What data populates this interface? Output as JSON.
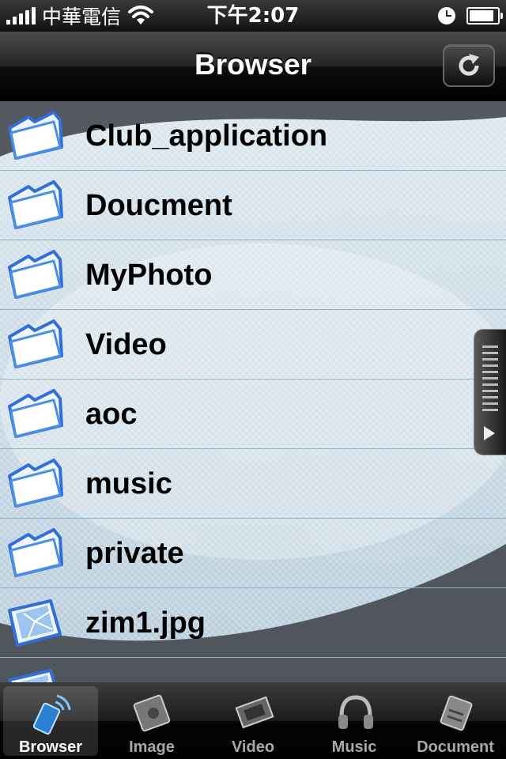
{
  "status_bar": {
    "carrier": "中華電信",
    "time": "下午2:07",
    "battery_level": 0.8
  },
  "navbar": {
    "title": "Browser"
  },
  "list": {
    "items": [
      {
        "label": "Club_application",
        "icon": "folder-icon"
      },
      {
        "label": "Doucment",
        "icon": "folder-icon"
      },
      {
        "label": "MyPhoto",
        "icon": "folder-icon"
      },
      {
        "label": "Video",
        "icon": "folder-icon"
      },
      {
        "label": "aoc",
        "icon": "folder-icon"
      },
      {
        "label": "music",
        "icon": "folder-icon"
      },
      {
        "label": "private",
        "icon": "folder-icon"
      },
      {
        "label": "zim1.jpg",
        "icon": "image-file-icon"
      },
      {
        "label": "",
        "icon": "image-file-icon"
      }
    ]
  },
  "tabbar": {
    "tabs": [
      {
        "label": "Browser",
        "icon": "phone-wireless-icon",
        "active": true
      },
      {
        "label": "Image",
        "icon": "image-icon",
        "active": false
      },
      {
        "label": "Video",
        "icon": "film-icon",
        "active": false
      },
      {
        "label": "Music",
        "icon": "headphones-icon",
        "active": false
      },
      {
        "label": "Document",
        "icon": "document-icon",
        "active": false
      }
    ]
  },
  "colors": {
    "accent": "#4aa3e8",
    "row_divider": "#8fb3cf"
  }
}
